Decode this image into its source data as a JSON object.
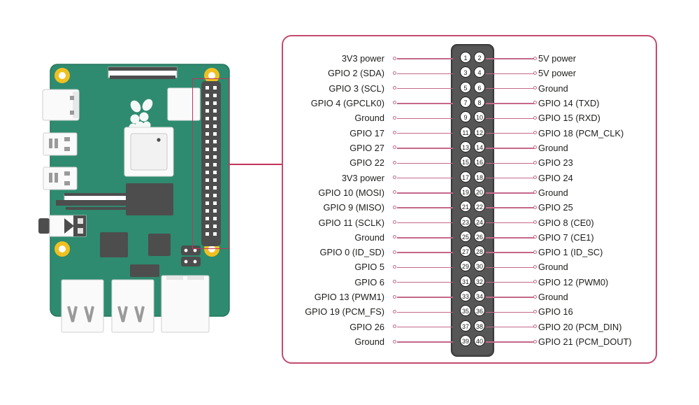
{
  "diagram": {
    "title": "Raspberry Pi 40-pin GPIO header pinout",
    "colors": {
      "panel_border": "#c44a6e",
      "lead_line": "#c4688a",
      "callout": "#c4335c",
      "header_block": "#3b3b3b",
      "header_inner": "#565656",
      "board_green": "#2e8b6f",
      "mount_hole": "#f0c020",
      "label_text": "#1d1d1b"
    }
  },
  "board": {
    "name": "raspberry-pi-board",
    "logo": "raspberry-icon",
    "ports": [
      {
        "name": "usb-c-power-port"
      },
      {
        "name": "micro-hdmi-port-0"
      },
      {
        "name": "micro-hdmi-port-1"
      },
      {
        "name": "av-jack-port"
      },
      {
        "name": "usb-2-ports"
      },
      {
        "name": "usb-3-ports"
      },
      {
        "name": "ethernet-port"
      },
      {
        "name": "csi-camera-connector"
      },
      {
        "name": "dsi-display-connector"
      }
    ]
  },
  "pins": [
    {
      "num_left": "1",
      "num_right": "2",
      "label_left": "3V3 power",
      "label_right": "5V power"
    },
    {
      "num_left": "3",
      "num_right": "4",
      "label_left": "GPIO 2 (SDA)",
      "label_right": "5V power"
    },
    {
      "num_left": "5",
      "num_right": "6",
      "label_left": "GPIO 3 (SCL)",
      "label_right": "Ground"
    },
    {
      "num_left": "7",
      "num_right": "8",
      "label_left": "GPIO 4 (GPCLK0)",
      "label_right": "GPIO 14 (TXD)"
    },
    {
      "num_left": "9",
      "num_right": "10",
      "label_left": "Ground",
      "label_right": "GPIO 15 (RXD)"
    },
    {
      "num_left": "11",
      "num_right": "12",
      "label_left": "GPIO 17",
      "label_right": "GPIO 18 (PCM_CLK)"
    },
    {
      "num_left": "13",
      "num_right": "14",
      "label_left": "GPIO 27",
      "label_right": "Ground"
    },
    {
      "num_left": "15",
      "num_right": "16",
      "label_left": "GPIO 22",
      "label_right": "GPIO 23"
    },
    {
      "num_left": "17",
      "num_right": "18",
      "label_left": "3V3 power",
      "label_right": "GPIO 24"
    },
    {
      "num_left": "19",
      "num_right": "20",
      "label_left": "GPIO 10 (MOSI)",
      "label_right": "Ground"
    },
    {
      "num_left": "21",
      "num_right": "22",
      "label_left": "GPIO 9 (MISO)",
      "label_right": "GPIO 25"
    },
    {
      "num_left": "23",
      "num_right": "24",
      "label_left": "GPIO 11 (SCLK)",
      "label_right": "GPIO 8 (CE0)"
    },
    {
      "num_left": "25",
      "num_right": "26",
      "label_left": "Ground",
      "label_right": "GPIO 7 (CE1)"
    },
    {
      "num_left": "27",
      "num_right": "28",
      "label_left": "GPIO 0 (ID_SD)",
      "label_right": "GPIO 1 (ID_SC)"
    },
    {
      "num_left": "29",
      "num_right": "30",
      "label_left": "GPIO 5",
      "label_right": "Ground"
    },
    {
      "num_left": "31",
      "num_right": "32",
      "label_left": "GPIO 6",
      "label_right": "GPIO 12 (PWM0)"
    },
    {
      "num_left": "33",
      "num_right": "34",
      "label_left": "GPIO 13 (PWM1)",
      "label_right": "Ground"
    },
    {
      "num_left": "35",
      "num_right": "36",
      "label_left": "GPIO 19 (PCM_FS)",
      "label_right": "GPIO 16"
    },
    {
      "num_left": "37",
      "num_right": "38",
      "label_left": "GPIO 26",
      "label_right": "GPIO 20 (PCM_DIN)"
    },
    {
      "num_left": "39",
      "num_right": "40",
      "label_left": "Ground",
      "label_right": "GPIO 21 (PCM_DOUT)"
    }
  ]
}
